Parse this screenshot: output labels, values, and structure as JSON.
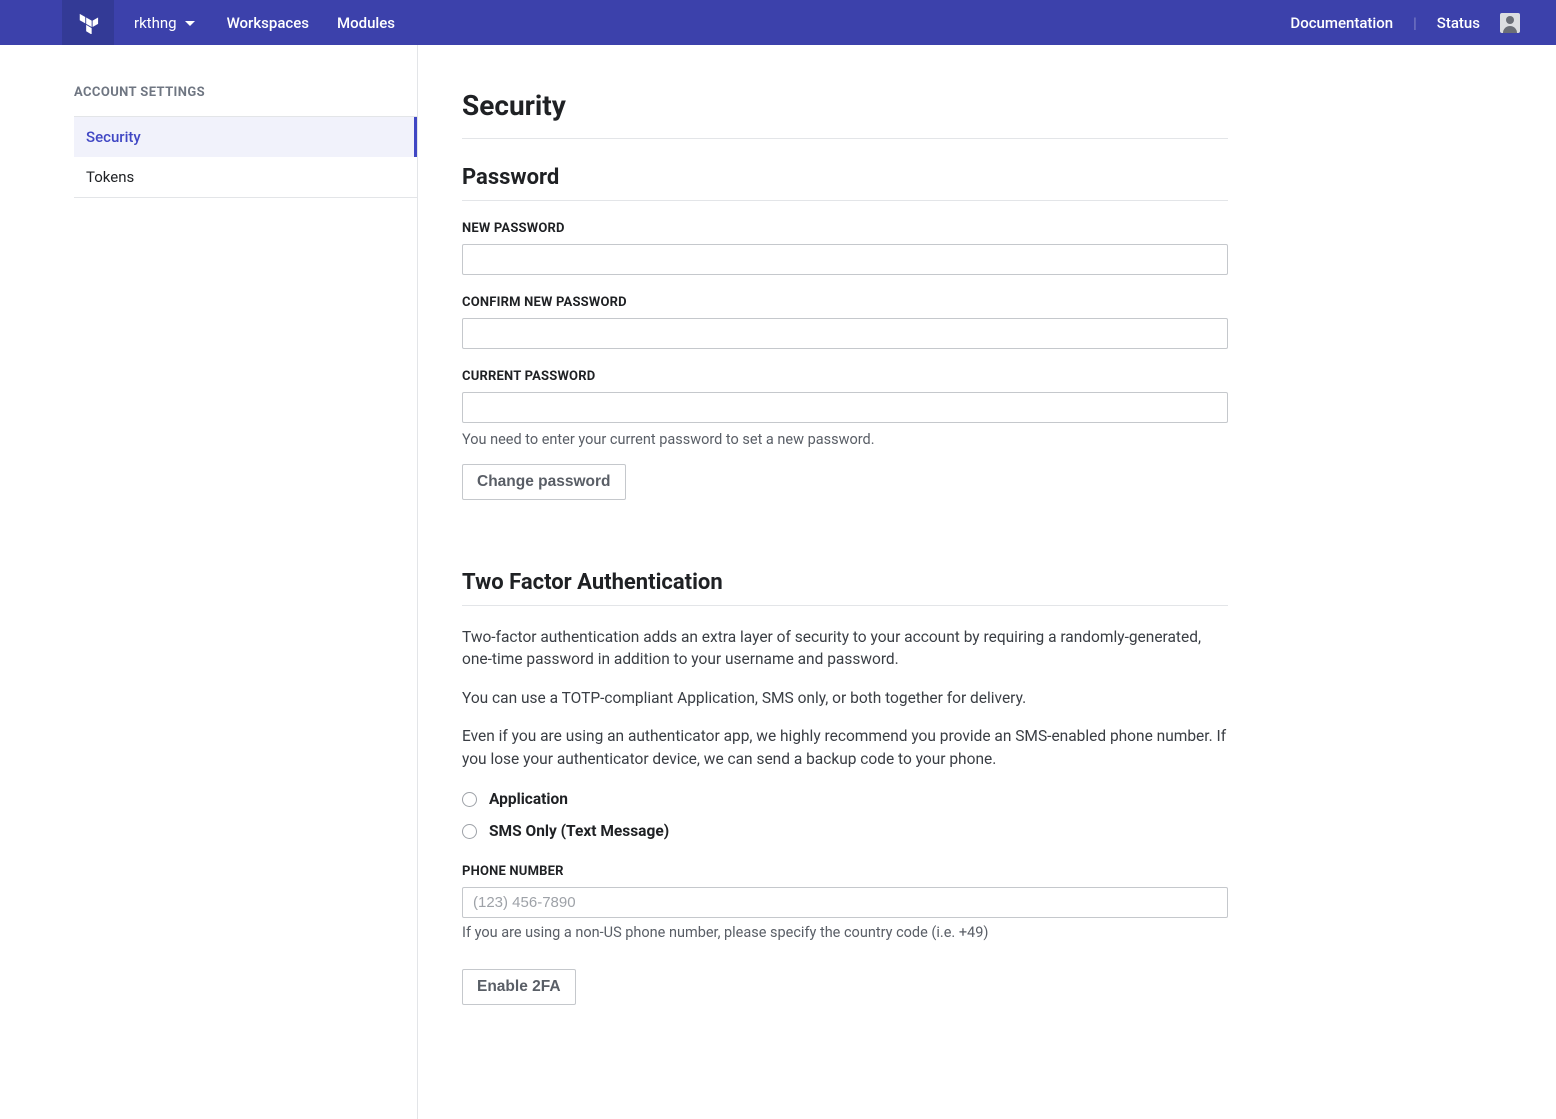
{
  "topbar": {
    "org_name": "rkthng",
    "nav": {
      "workspaces": "Workspaces",
      "modules": "Modules"
    },
    "right": {
      "documentation": "Documentation",
      "status": "Status"
    }
  },
  "sidebar": {
    "heading": "ACCOUNT SETTINGS",
    "items": [
      {
        "label": "Security",
        "active": true
      },
      {
        "label": "Tokens",
        "active": false
      }
    ]
  },
  "page": {
    "title": "Security"
  },
  "password": {
    "section_title": "Password",
    "new_label": "NEW PASSWORD",
    "new_value": "",
    "confirm_label": "CONFIRM NEW PASSWORD",
    "confirm_value": "",
    "current_label": "CURRENT PASSWORD",
    "current_value": "",
    "help": "You need to enter your current password to set a new password.",
    "button": "Change password"
  },
  "tfa": {
    "section_title": "Two Factor Authentication",
    "p1": "Two-factor authentication adds an extra layer of security to your account by requiring a randomly-generated, one-time password in addition to your username and password.",
    "p2": "You can use a TOTP-compliant Application, SMS only, or both together for delivery.",
    "p3": "Even if you are using an authenticator app, we highly recommend you provide an SMS-enabled phone number. If you lose your authenticator device, we can send a backup code to your phone.",
    "options": [
      {
        "label": "Application",
        "selected": false
      },
      {
        "label": "SMS Only (Text Message)",
        "selected": false
      }
    ],
    "phone_label": "PHONE NUMBER",
    "phone_placeholder": "(123) 456-7890",
    "phone_value": "",
    "phone_help": "If you are using a non-US phone number, please specify the country code (i.e. +49)",
    "button": "Enable 2FA"
  }
}
